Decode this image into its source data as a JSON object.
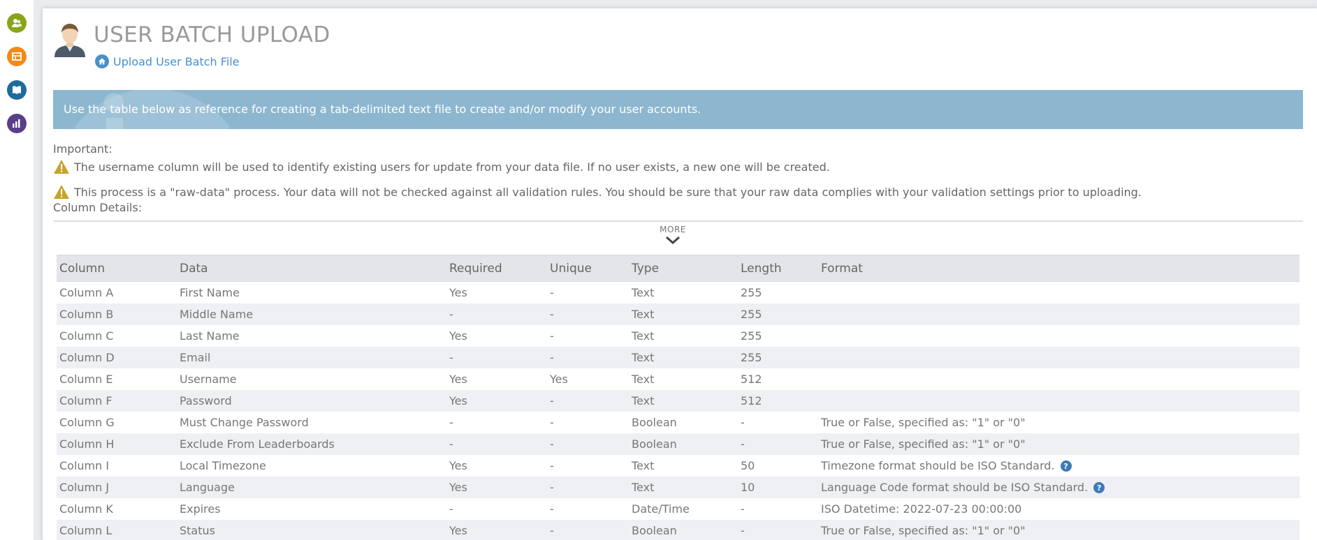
{
  "sidebar": {
    "items": [
      {
        "icon": "users-icon",
        "color": "#8aa516"
      },
      {
        "icon": "layout-icon",
        "color": "#f08a1c"
      },
      {
        "icon": "book-icon",
        "color": "#1f6b9c"
      },
      {
        "icon": "chart-icon",
        "color": "#5a3f86"
      }
    ]
  },
  "header": {
    "title": "USER BATCH UPLOAD",
    "upload_link": "Upload User Batch File"
  },
  "info_banner": {
    "text": "Use the table below as reference for creating a tab-delimited text file to create and/or modify your user accounts."
  },
  "important": {
    "label": "Important:",
    "warnings": [
      "The username column will be used to identify existing users for update from your data file. If no user exists, a new one will be created.",
      "This process is a \"raw-data\" process. Your data will not be checked against all validation rules. You should be sure that your raw data complies with your validation settings prior to uploading."
    ],
    "column_details": "Column Details:"
  },
  "more": {
    "label": "MORE"
  },
  "table": {
    "headers": [
      "Column",
      "Data",
      "Required",
      "Unique",
      "Type",
      "Length",
      "Format"
    ],
    "rows": [
      {
        "column": "Column A",
        "data": "First Name",
        "required": "Yes",
        "unique": "-",
        "type": "Text",
        "length": "255",
        "format": ""
      },
      {
        "column": "Column B",
        "data": "Middle Name",
        "required": "-",
        "unique": "-",
        "type": "Text",
        "length": "255",
        "format": ""
      },
      {
        "column": "Column C",
        "data": "Last Name",
        "required": "Yes",
        "unique": "-",
        "type": "Text",
        "length": "255",
        "format": ""
      },
      {
        "column": "Column D",
        "data": "Email",
        "required": "-",
        "unique": "-",
        "type": "Text",
        "length": "255",
        "format": ""
      },
      {
        "column": "Column E",
        "data": "Username",
        "required": "Yes",
        "unique": "Yes",
        "type": "Text",
        "length": "512",
        "format": ""
      },
      {
        "column": "Column F",
        "data": "Password",
        "required": "Yes",
        "unique": "-",
        "type": "Text",
        "length": "512",
        "format": ""
      },
      {
        "column": "Column G",
        "data": "Must Change Password",
        "required": "-",
        "unique": "-",
        "type": "Boolean",
        "length": "-",
        "format": "True or False, specified as: \"1\" or \"0\""
      },
      {
        "column": "Column H",
        "data": "Exclude From Leaderboards",
        "required": "-",
        "unique": "-",
        "type": "Boolean",
        "length": "-",
        "format": "True or False, specified as: \"1\" or \"0\""
      },
      {
        "column": "Column I",
        "data": "Local Timezone",
        "required": "Yes",
        "unique": "-",
        "type": "Text",
        "length": "50",
        "format": "Timezone format should be ISO Standard.",
        "help": true
      },
      {
        "column": "Column J",
        "data": "Language",
        "required": "Yes",
        "unique": "-",
        "type": "Text",
        "length": "10",
        "format": "Language Code format should be ISO Standard.",
        "help": true
      },
      {
        "column": "Column K",
        "data": "Expires",
        "required": "-",
        "unique": "-",
        "type": "Date/Time",
        "length": "-",
        "format": "ISO Datetime: 2022-07-23 00:00:00"
      },
      {
        "column": "Column L",
        "data": "Status",
        "required": "Yes",
        "unique": "-",
        "type": "Boolean",
        "length": "-",
        "format": "True or False, specified as: \"1\" or \"0\""
      }
    ]
  },
  "colors": {
    "link": "#4a8fc9",
    "banner": "#8cb7cf",
    "warning": "#c9a227",
    "help": "#3d7ab8"
  }
}
